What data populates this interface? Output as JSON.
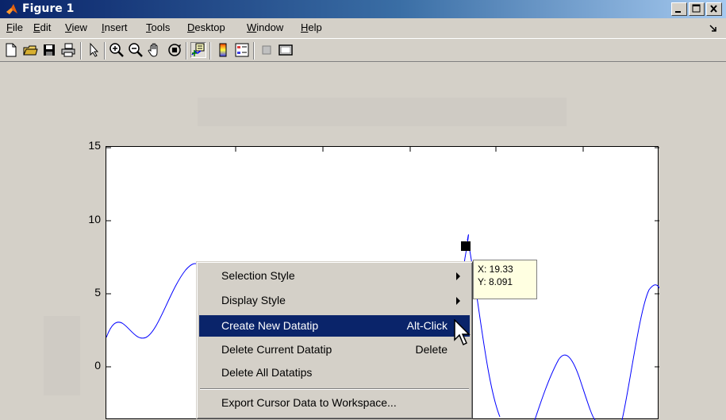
{
  "window": {
    "title": "Figure 1"
  },
  "menu": [
    {
      "label": "File",
      "mnemonic": "F",
      "rest": "ile"
    },
    {
      "label": "Edit",
      "mnemonic": "E",
      "rest": "dit"
    },
    {
      "label": "View",
      "mnemonic": "V",
      "rest": "iew"
    },
    {
      "label": "Insert",
      "mnemonic": "I",
      "rest": "nsert"
    },
    {
      "label": "Tools",
      "mnemonic": "T",
      "rest": "ools"
    },
    {
      "label": "Desktop",
      "mnemonic": "D",
      "rest": "esktop"
    },
    {
      "label": "Window",
      "mnemonic": "W",
      "rest": "indow"
    },
    {
      "label": "Help",
      "mnemonic": "H",
      "rest": "elp"
    }
  ],
  "toolbar": {
    "icons": [
      "new-figure-icon",
      "open-file-icon",
      "save-icon",
      "print-icon",
      "edit-plot-arrow-icon",
      "zoom-in-icon",
      "zoom-out-icon",
      "pan-hand-icon",
      "rotate-3d-icon",
      "data-cursor-icon",
      "colorbar-icon",
      "legend-icon",
      "hide-plot-tools-icon",
      "show-plot-tools-icon"
    ],
    "pressed": "data-cursor-icon"
  },
  "axes": {
    "yticks": [
      "15",
      "10",
      "5",
      "0"
    ]
  },
  "datatip": {
    "x_text": "X: 19.33",
    "y_text": "Y: 8.091"
  },
  "context_menu": {
    "items": [
      {
        "label": "Selection Style",
        "accel": "",
        "submenu": true,
        "highlighted": false
      },
      {
        "label": "Display Style",
        "accel": "",
        "submenu": true,
        "highlighted": false
      },
      {
        "label": "Create New Datatip",
        "accel": "Alt-Click",
        "submenu": false,
        "highlighted": true
      },
      {
        "label": "Delete Current Datatip",
        "accel": "Delete",
        "submenu": false,
        "highlighted": false
      },
      {
        "label": "Delete All Datatips",
        "accel": "",
        "submenu": false,
        "highlighted": false
      },
      {
        "label": "Export Cursor Data to Workspace...",
        "accel": "",
        "submenu": false,
        "highlighted": false
      }
    ]
  },
  "colors": {
    "highlight": "#0a246a",
    "line": "#0000ff",
    "datatip_bg": "#ffffe1",
    "face": "#d4d0c8"
  }
}
